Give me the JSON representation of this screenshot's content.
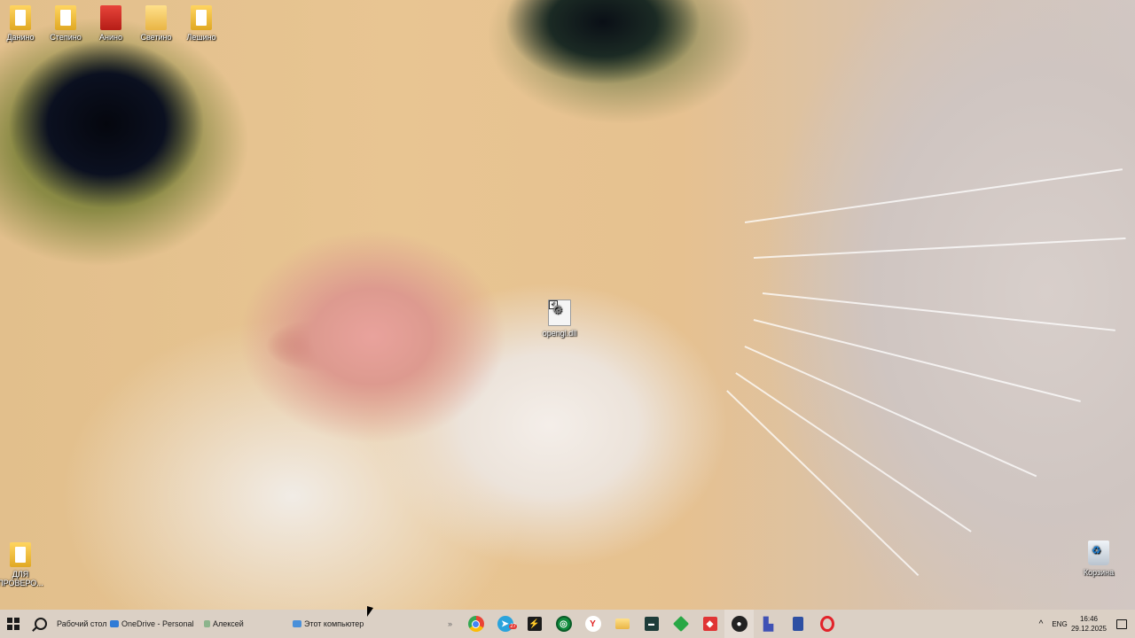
{
  "desktop": {
    "icons_top": [
      {
        "label": "Данино",
        "type": "pdf"
      },
      {
        "label": "Степино",
        "type": "pdf"
      },
      {
        "label": "Анино",
        "type": "doc-red"
      },
      {
        "label": "Светино",
        "type": "folder"
      },
      {
        "label": "Лешино",
        "type": "pdf"
      }
    ],
    "center_file": {
      "label": "opengl.dll",
      "checked": true
    },
    "left_file": {
      "label": "ДЛЯ ПРОВЕРО..."
    },
    "recycle_bin": {
      "label": "Корзина"
    }
  },
  "taskbar": {
    "toolbars": [
      {
        "label": "Рабочий стол"
      },
      {
        "label": "OneDrive - Personal"
      },
      {
        "label": "Алексей"
      },
      {
        "label": "Этот компьютер"
      }
    ],
    "overflow": "»",
    "pinned_apps": [
      {
        "name": "chrome-icon",
        "color": "#ea4335"
      },
      {
        "name": "telegram-icon",
        "color": "#2aa3dc",
        "badge": "27"
      },
      {
        "name": "winamp-icon",
        "color": "#1b1b1b"
      },
      {
        "name": "green-circle-app-icon",
        "color": "#0f8a3c"
      },
      {
        "name": "yandex-browser-icon",
        "color": "#ffffff"
      },
      {
        "name": "file-explorer-icon",
        "color": "#f2c94c"
      },
      {
        "name": "terminal-app-icon",
        "color": "#1e3d3a"
      },
      {
        "name": "green-cube-app-icon",
        "color": "#29a745"
      },
      {
        "name": "anydesk-icon",
        "color": "#e03434"
      },
      {
        "name": "obs-studio-icon",
        "color": "#222222"
      },
      {
        "name": "charts-app-icon",
        "color": "#3f51b5"
      },
      {
        "name": "calculator-icon",
        "color": "#2d4fa3"
      },
      {
        "name": "opera-icon",
        "color": "#e2232a"
      }
    ],
    "tray": {
      "language": "ENG",
      "time": "16:46",
      "date": "29.12.2025"
    }
  }
}
